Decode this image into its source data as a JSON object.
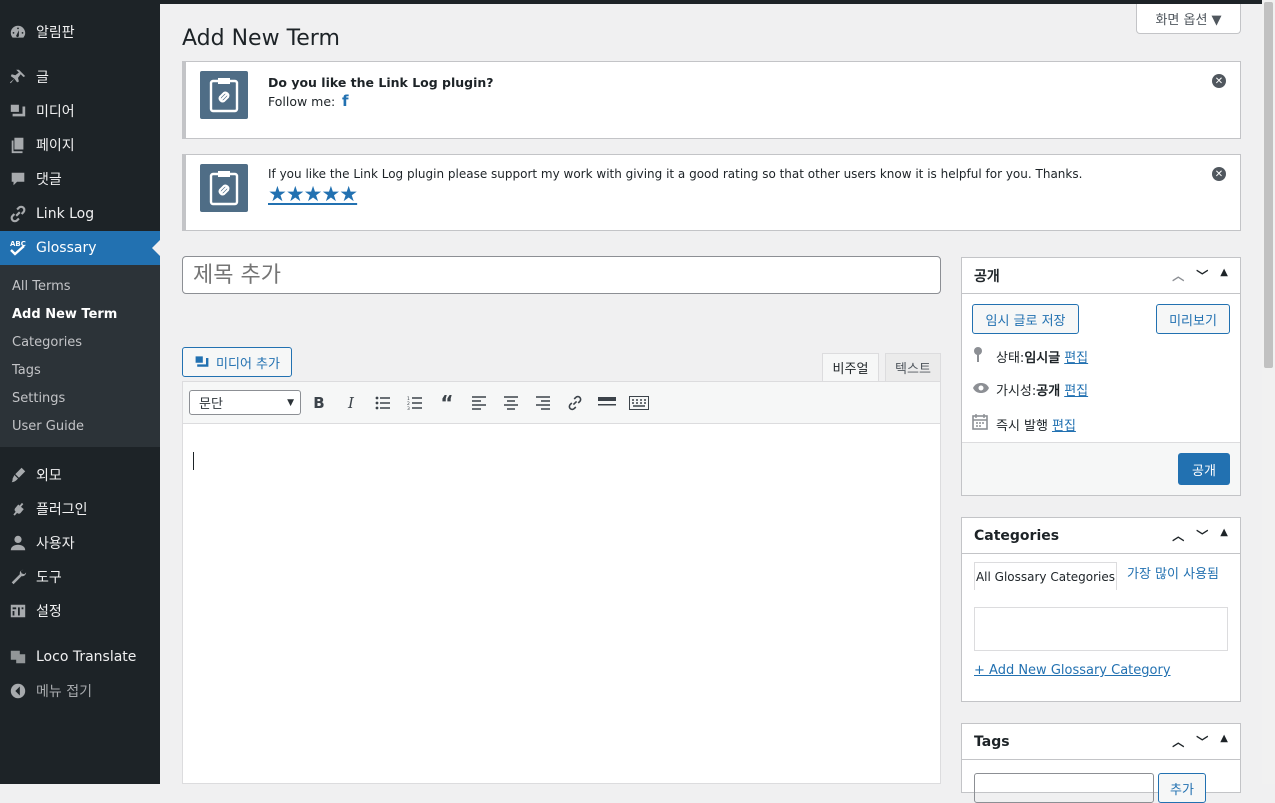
{
  "sidebar": {
    "items": [
      {
        "label": "알림판",
        "icon": "dashboard-icon"
      },
      {
        "label": "글",
        "icon": "pin-icon"
      },
      {
        "label": "미디어",
        "icon": "media-icon"
      },
      {
        "label": "페이지",
        "icon": "pages-icon"
      },
      {
        "label": "댓글",
        "icon": "comments-icon"
      },
      {
        "label": "Link Log",
        "icon": "link-icon"
      },
      {
        "label": "Glossary",
        "icon": "abc-check-icon"
      },
      {
        "label": "외모",
        "icon": "brush-icon"
      },
      {
        "label": "플러그인",
        "icon": "plugin-icon"
      },
      {
        "label": "사용자",
        "icon": "user-icon"
      },
      {
        "label": "도구",
        "icon": "wrench-icon"
      },
      {
        "label": "설정",
        "icon": "settings-icon"
      },
      {
        "label": "Loco Translate",
        "icon": "translate-icon"
      },
      {
        "label": "메뉴 접기",
        "icon": "collapse-icon"
      }
    ],
    "submenu": [
      "All Terms",
      "Add New Term",
      "Categories",
      "Tags",
      "Settings",
      "User Guide"
    ]
  },
  "header": {
    "screen_options": "화면 옵션 ▼",
    "title": "Add New Term"
  },
  "notices": {
    "n1_text": "Do you like the Link Log plugin?",
    "n1_follow": "Follow me:",
    "n2_text": "If you like the Link Log plugin please support my work with giving it a good rating so that other users know it is helpful for you. Thanks.",
    "n2_stars": "★★★★★"
  },
  "editor": {
    "title_placeholder": "제목 추가",
    "add_media": "미디어 추가",
    "tab_visual": "비주얼",
    "tab_text": "텍스트",
    "format": "문단"
  },
  "publish": {
    "title": "공개",
    "save_draft": "임시 글로 저장",
    "preview": "미리보기",
    "status_label": "상태: ",
    "status_value": "임시글",
    "visibility_label": "가시성: ",
    "visibility_value": "공개",
    "schedule_label": "즉시 발행",
    "edit": "편집",
    "publish_btn": "공개"
  },
  "categories": {
    "title": "Categories",
    "tab_all": "All Glossary Categories",
    "tab_popular": "가장 많이 사용됨",
    "add_new": "+ Add New Glossary Category"
  },
  "tags": {
    "title": "Tags",
    "add_btn": "추가"
  },
  "colors": {
    "accent": "#2271b1",
    "sidebar": "#1d2327"
  }
}
